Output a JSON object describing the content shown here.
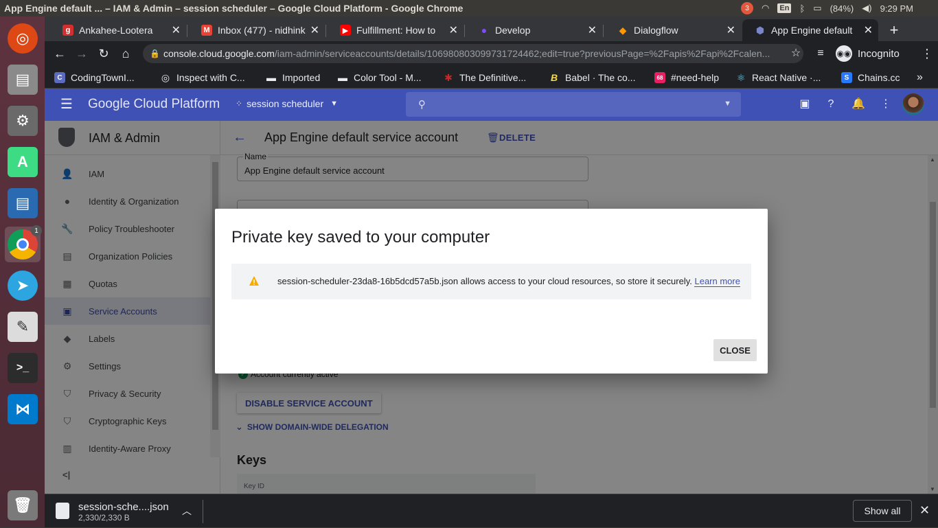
{
  "window": {
    "title": "App Engine default ... – IAM & Admin – session scheduler – Google Cloud Platform - Google Chrome",
    "system": {
      "notif_count": "3",
      "lang": "En",
      "battery": "(84%)",
      "time": "9:29 PM"
    }
  },
  "launcher": {
    "chrome_badge": "1"
  },
  "tabs": [
    {
      "label": "Ankahee-Lootera",
      "fav": "g",
      "color": "#d32f2f"
    },
    {
      "label": "Inbox (477) - nidhink",
      "fav": "M",
      "color": "#ea4335"
    },
    {
      "label": "Fulfillment: How to",
      "fav": "▶",
      "color": "#ff0000"
    },
    {
      "label": "Develop",
      "fav": "●",
      "color": "#7c4dff"
    },
    {
      "label": "Dialogflow",
      "fav": "◆",
      "color": "#ff9800"
    },
    {
      "label": "App Engine default",
      "fav": "⬢",
      "color": "#5c6bc0"
    }
  ],
  "url": {
    "host": "console.cloud.google.com",
    "path": "/iam-admin/serviceaccounts/details/106980803099731724462;edit=true?previousPage=%2Fapis%2Fapi%2Fcalen..."
  },
  "profile": {
    "label": "Incognito"
  },
  "bookmarks": [
    {
      "label": "CodingTownI...",
      "color": "#5c6bc0",
      "glyph": "C"
    },
    {
      "label": "Inspect with C...",
      "color": "#9aa0a6",
      "glyph": "◎"
    },
    {
      "label": "Imported",
      "color": "#9aa0a6",
      "glyph": "▬"
    },
    {
      "label": "Color Tool - M...",
      "color": "#9aa0a6",
      "glyph": "▬"
    },
    {
      "label": "The Definitive...",
      "color": "#c62828",
      "glyph": "✱"
    },
    {
      "label": "Babel · The co...",
      "color": "#f9dc3e",
      "glyph": "B"
    },
    {
      "label": "#need-help",
      "color": "#e91e63",
      "glyph": "68"
    },
    {
      "label": "React Native ·...",
      "color": "#61dafb",
      "glyph": "⚛"
    },
    {
      "label": "Chains.cc",
      "color": "#2979ff",
      "glyph": "S"
    }
  ],
  "gcp": {
    "brand": "Google Cloud Platform",
    "project": "session scheduler"
  },
  "sidebar": {
    "title": "IAM & Admin",
    "items": [
      {
        "label": "IAM",
        "icon": "person-add-icon",
        "glyph": "👤"
      },
      {
        "label": "Identity & Organization",
        "icon": "account-circle-icon",
        "glyph": "●"
      },
      {
        "label": "Policy Troubleshooter",
        "icon": "wrench-icon",
        "glyph": "🔧"
      },
      {
        "label": "Organization Policies",
        "icon": "document-icon",
        "glyph": "▤"
      },
      {
        "label": "Quotas",
        "icon": "quotas-icon",
        "glyph": "▦"
      },
      {
        "label": "Service Accounts",
        "icon": "service-account-icon",
        "glyph": "▣"
      },
      {
        "label": "Labels",
        "icon": "label-icon",
        "glyph": "◆"
      },
      {
        "label": "Settings",
        "icon": "gear-icon",
        "glyph": "⚙"
      },
      {
        "label": "Privacy & Security",
        "icon": "shield-icon",
        "glyph": "⛉"
      },
      {
        "label": "Cryptographic Keys",
        "icon": "key-shield-icon",
        "glyph": "⛉"
      },
      {
        "label": "Identity-Aware Proxy",
        "icon": "proxy-icon",
        "glyph": "▥"
      }
    ],
    "collapse": "<|"
  },
  "page": {
    "title": "App Engine default service account",
    "delete_label": "DELETE",
    "name_label": "Name",
    "name_value": "App Engine default service account",
    "status_text": "Account currently active",
    "disable_label": "DISABLE SERVICE ACCOUNT",
    "delegation_label": "SHOW DOMAIN-WIDE DELEGATION",
    "keys_heading": "Keys",
    "keys_col_keyid": "Key ID"
  },
  "dialog": {
    "title": "Private key saved to your computer",
    "message": "session-scheduler-23da8-16b5dcd57a5b.json allows access to your cloud resources, so store it securely.",
    "learn_more": "Learn more",
    "close_label": "CLOSE"
  },
  "download": {
    "filename": "session-sche....json",
    "size": "2,330/2,330 B",
    "show_all": "Show all"
  },
  "colors": {
    "gcp_blue": "#3f51b5",
    "chrome_dark": "#202124",
    "ubuntu_launcher": "#5e3340"
  }
}
